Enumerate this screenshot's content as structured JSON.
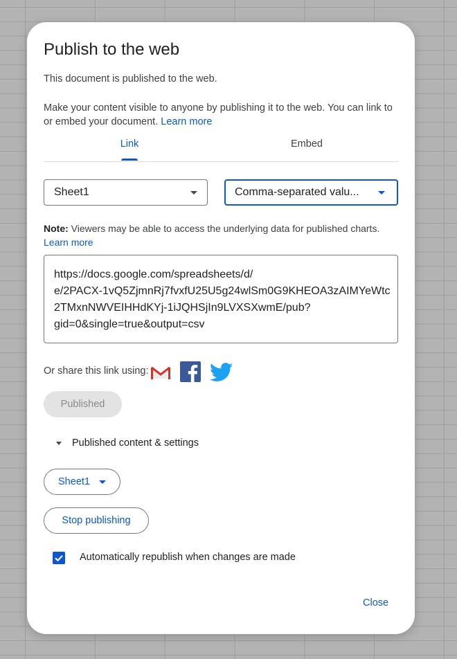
{
  "dialog": {
    "title": "Publish to the web",
    "status": "This document is published to the web.",
    "description": "Make your content visible to anyone by publishing it to the web. You can link to or embed your document.",
    "learn_more": "Learn more",
    "tabs": [
      {
        "label": "Link",
        "active": true
      },
      {
        "label": "Embed",
        "active": false
      }
    ],
    "sheet_select": "Sheet1",
    "format_select": "Comma-separated valu...",
    "note_label": "Note:",
    "note_text": "Viewers may be able to access the underlying data for published charts.",
    "note_learn_more": "Learn more",
    "url_lines": [
      "https://docs.google.com/spreadsheets/d/",
      "e/2PACX-1vQ5ZjmnRj7fvxfU25U5g24wlSm0G9KHEOA3zAIMYeWtc",
      "2TMxnNWVEIHHdKYj-1iJQHSjIn9LVXSXwmE/pub?",
      "gid=0&single=true&output=csv"
    ],
    "share_label": "Or share this link using:",
    "share_icons": [
      "gmail-icon",
      "facebook-icon",
      "twitter-icon"
    ],
    "published_button": "Published",
    "published_settings_label": "Published content & settings",
    "sheet_button": "Sheet1",
    "stop_button": "Stop publishing",
    "auto_republish_label": "Automatically republish when changes are made",
    "auto_republish_checked": true,
    "close_button": "Close"
  },
  "colors": {
    "accent": "#0b57d0",
    "gmail_red": "#d93025",
    "facebook_blue": "#3b5998",
    "twitter_blue": "#1da1f2"
  }
}
